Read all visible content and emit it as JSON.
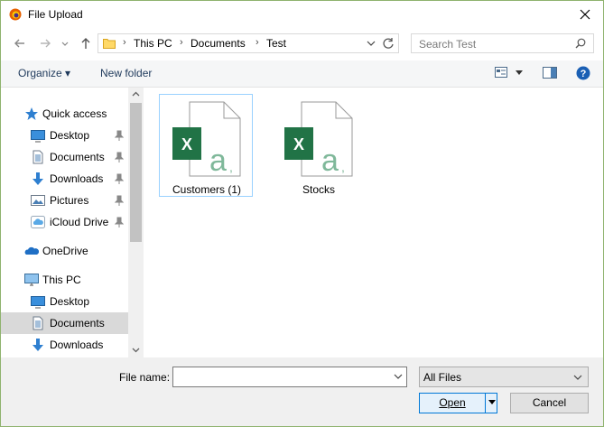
{
  "window": {
    "title": "File Upload"
  },
  "address": {
    "crumbs": [
      "This PC",
      "Documents",
      "Test"
    ]
  },
  "search": {
    "placeholder": "Search Test"
  },
  "toolbar": {
    "organize_label": "Organize ▾",
    "new_folder_label": "New folder"
  },
  "nav": {
    "items": [
      {
        "label": "Quick access",
        "icon": "star-icon"
      },
      {
        "label": "Desktop",
        "icon": "desktop-icon",
        "pinned": true
      },
      {
        "label": "Documents",
        "icon": "documents-icon",
        "pinned": true
      },
      {
        "label": "Downloads",
        "icon": "downloads-icon",
        "pinned": true
      },
      {
        "label": "Pictures",
        "icon": "pictures-icon",
        "pinned": true
      },
      {
        "label": "iCloud Drive",
        "icon": "icloud-icon",
        "pinned": true
      },
      {
        "label": "OneDrive",
        "icon": "onedrive-icon"
      },
      {
        "label": "This PC",
        "icon": "computer-icon"
      },
      {
        "label": "Desktop",
        "icon": "desktop-icon"
      },
      {
        "label": "Documents",
        "icon": "documents-icon",
        "selected": true
      },
      {
        "label": "Downloads",
        "icon": "downloads-icon"
      }
    ]
  },
  "files": [
    {
      "name": "Customers (1)",
      "icon": "excel-csv-icon",
      "focused": true
    },
    {
      "name": "Stocks",
      "icon": "excel-csv-icon"
    }
  ],
  "bottom": {
    "file_name_label": "File name:",
    "file_name_value": "",
    "filter_value": "All Files",
    "open_label": "Open",
    "cancel_label": "Cancel"
  },
  "colors": {
    "excel_green": "#217346",
    "accent_blue": "#0078d7",
    "selection": "#d9d9d9"
  }
}
